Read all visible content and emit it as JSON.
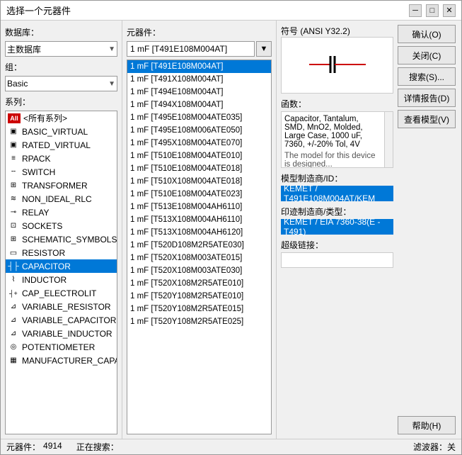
{
  "window": {
    "title": "选择一个元器件"
  },
  "titlebar": {
    "minimize_label": "─",
    "maximize_label": "□",
    "close_label": "✕"
  },
  "left": {
    "database_label": "数据库：",
    "database_value": "主数据库",
    "group_label": "组：",
    "group_value": "Basic",
    "series_label": "系列：",
    "series_items": [
      {
        "icon": "All",
        "icon_type": "all",
        "label": "<所有系列>",
        "selected": false
      },
      {
        "icon": "▣",
        "icon_type": "basic",
        "label": "BASIC_VIRTUAL",
        "selected": false
      },
      {
        "icon": "▣",
        "icon_type": "rated",
        "label": "RATED_VIRTUAL",
        "selected": false
      },
      {
        "icon": "≡",
        "icon_type": "rpack",
        "label": "RPACK",
        "selected": false
      },
      {
        "icon": "╌",
        "icon_type": "switch",
        "label": "SWITCH",
        "selected": false
      },
      {
        "icon": "≋",
        "icon_type": "transformer",
        "label": "TRANSFORMER",
        "selected": false
      },
      {
        "icon": "≈",
        "icon_type": "rlc",
        "label": "NON_IDEAL_RLC",
        "selected": false
      },
      {
        "icon": "⊸",
        "icon_type": "relay",
        "label": "RELAY",
        "selected": false
      },
      {
        "icon": "⊡",
        "icon_type": "sockets",
        "label": "SOCKETS",
        "selected": false
      },
      {
        "icon": "⊞",
        "icon_type": "schematic",
        "label": "SCHEMATIC_SYMBOLS",
        "selected": false
      },
      {
        "icon": "Ω",
        "icon_type": "resistor",
        "label": "RESISTOR",
        "selected": false
      },
      {
        "icon": "┤├",
        "icon_type": "capacitor",
        "label": "CAPACITOR",
        "selected": true
      },
      {
        "icon": "⌇",
        "icon_type": "inductor",
        "label": "INDUCTOR",
        "selected": false
      },
      {
        "icon": "⊣⊢",
        "icon_type": "cap_e",
        "label": "CAP_ELECTROLIT",
        "selected": false
      },
      {
        "icon": "⊿",
        "icon_type": "var_r",
        "label": "VARIABLE_RESISTOR",
        "selected": false
      },
      {
        "icon": "⊿",
        "icon_type": "var_c",
        "label": "VARIABLE_CAPACITOR",
        "selected": false
      },
      {
        "icon": "⊿",
        "icon_type": "var_i",
        "label": "VARIABLE_INDUCTOR",
        "selected": false
      },
      {
        "icon": "◎",
        "icon_type": "pot",
        "label": "POTENTIOMETER",
        "selected": false
      },
      {
        "icon": "▦",
        "icon_type": "mfr",
        "label": "MANUFACTURER_CAPA...",
        "selected": false
      }
    ]
  },
  "middle": {
    "components_label": "元器件：",
    "search_value": "1 mF [T491E108M004AT]",
    "components": [
      {
        "label": "1 mF  [T491E108M004AT]",
        "selected": true
      },
      {
        "label": "1 mF  [T491X108M004AT]",
        "selected": false
      },
      {
        "label": "1 mF  [T494E108M004AT]",
        "selected": false
      },
      {
        "label": "1 mF  [T494X108M004AT]",
        "selected": false
      },
      {
        "label": "1 mF  [T495E108M004ATE035]",
        "selected": false
      },
      {
        "label": "1 mF  [T495E108M006ATE050]",
        "selected": false
      },
      {
        "label": "1 mF  [T495X108M004ATE070]",
        "selected": false
      },
      {
        "label": "1 mF  [T510E108M004ATE010]",
        "selected": false
      },
      {
        "label": "1 mF  [T510E108M004ATE018]",
        "selected": false
      },
      {
        "label": "1 mF  [T510X108M004ATE018]",
        "selected": false
      },
      {
        "label": "1 mF  [T510E108M004ATE023]",
        "selected": false
      },
      {
        "label": "1 mF  [T513E108M004AH6110]",
        "selected": false
      },
      {
        "label": "1 mF  [T513X108M004AH6110]",
        "selected": false
      },
      {
        "label": "1 mF  [T513X108M004AH6120]",
        "selected": false
      },
      {
        "label": "1 mF  [T520D108M2R5ATE030]",
        "selected": false
      },
      {
        "label": "1 mF  [T520X108M003ATE015]",
        "selected": false
      },
      {
        "label": "1 mF  [T520X108M003ATE030]",
        "selected": false
      },
      {
        "label": "1 mF  [T520X108M2R5ATE010]",
        "selected": false
      },
      {
        "label": "1 mF  [T520Y108M2R5ATE010]",
        "selected": false
      },
      {
        "label": "1 mF  [T520Y108M2R5ATE015]",
        "selected": false
      },
      {
        "label": "1 mF  [T520Y108M2R5ATE025]",
        "selected": false
      }
    ]
  },
  "right": {
    "symbol_label": "符号 (ANSI Y32.2)",
    "function_label": "函数：",
    "function_text": "Capacitor, Tantalum, SMD, MnO2, Molded, Large Case, 1000 uF, 7360, +/-20% Tol, 4V",
    "function_text2": "The model for this device is designed...",
    "model_label": "模型制造商/ID：",
    "model_value": "KEMET / T491E108M004AT/KEM",
    "footprint_label": "印迹制造商/类型：",
    "footprint_value": "KEMET / EIA 7360-38(E - T491)",
    "hyperlink_label": "超级链接："
  },
  "buttons": {
    "confirm": "确认(O)",
    "close": "关闭(C)",
    "search": "搜索(S)...",
    "detail": "详情报告(D)",
    "model": "查看模型(V)",
    "help": "帮助(H)"
  },
  "statusbar": {
    "comp_label": "元器件：",
    "comp_count": "4914",
    "searching_label": "正在搜索：",
    "searching_value": "",
    "filter_label": "滤波器：关"
  }
}
